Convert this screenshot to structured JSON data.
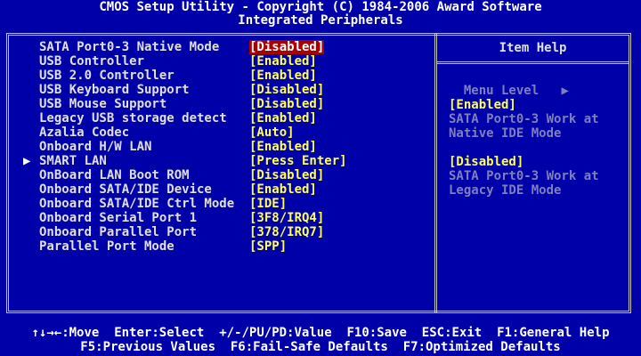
{
  "title": {
    "line1": "CMOS Setup Utility - Copyright (C) 1984-2006 Award Software",
    "line2": "Integrated Peripherals"
  },
  "menu": {
    "items": [
      {
        "label": "SATA Port0-3 Native Mode",
        "value": "[Disabled]",
        "selected": true
      },
      {
        "label": "USB Controller",
        "value": "[Enabled]"
      },
      {
        "label": "USB 2.0 Controller",
        "value": "[Enabled]"
      },
      {
        "label": "USB Keyboard Support",
        "value": "[Disabled]"
      },
      {
        "label": "USB Mouse Support",
        "value": "[Disabled]"
      },
      {
        "label": "Legacy USB storage detect",
        "value": "[Enabled]"
      },
      {
        "label": "Azalia Codec",
        "value": "[Auto]"
      },
      {
        "label": "Onboard H/W LAN",
        "value": "[Enabled]"
      },
      {
        "label": "SMART LAN",
        "value": "[Press Enter]",
        "submenu": true,
        "arrow": "▶"
      },
      {
        "label": "OnBoard LAN Boot ROM",
        "value": "[Disabled]"
      },
      {
        "label": "Onboard SATA/IDE Device",
        "value": "[Enabled]"
      },
      {
        "label": "Onboard SATA/IDE Ctrl Mode",
        "value": "[IDE]"
      },
      {
        "label": "Onboard Serial Port 1",
        "value": "[3F8/IRQ4]"
      },
      {
        "label": "Onboard Parallel Port",
        "value": "[378/IRQ7]"
      },
      {
        "label": "Parallel Port Mode",
        "value": "[SPP]"
      }
    ]
  },
  "help": {
    "title": "Item Help",
    "menu_level": "Menu Level",
    "menu_level_arrow": "▶",
    "opt1_value": "[Enabled]",
    "opt1_line1": "SATA Port0-3 Work at",
    "opt1_line2": "Native IDE Mode",
    "opt2_value": "[Disabled]",
    "opt2_line1": "SATA Port0-3 Work at",
    "opt2_line2": "Legacy IDE Mode"
  },
  "footer": {
    "line1": "↑↓→←:Move  Enter:Select  +/-/PU/PD:Value  F10:Save  ESC:Exit  F1:General Help",
    "line2": "F5:Previous Values  F6:Fail-Safe Defaults  F7:Optimized Defaults"
  },
  "colors": {
    "background": "#0000a8",
    "value_text": "#ffff54",
    "selected_bg": "#a80000",
    "label_text": "#e0e0e0",
    "dim_text": "#7f7fc0"
  }
}
